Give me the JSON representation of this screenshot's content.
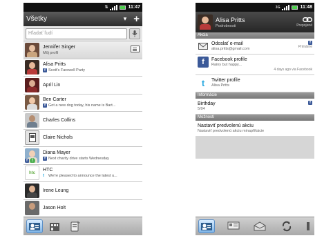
{
  "left": {
    "status": {
      "time": "11:47"
    },
    "header": {
      "title": "Všetky",
      "chevron": "▾",
      "add": "+"
    },
    "search": {
      "placeholder": "Hľadať ľudí"
    },
    "contacts": [
      {
        "name": "Jennifer Singer",
        "sub": "Môj profil",
        "icon": "none"
      },
      {
        "name": "Alisa Pritts",
        "sub": "Scott's Farewell Party",
        "icon": "facebook"
      },
      {
        "name": "April Lin",
        "sub": "",
        "icon": "none"
      },
      {
        "name": "Ben Carter",
        "sub": "Got a new dog today, his name is Bart...",
        "icon": "facebook"
      },
      {
        "name": "Charles Collins",
        "sub": "",
        "icon": "none"
      },
      {
        "name": "Claire Nichols",
        "sub": "",
        "icon": "none"
      },
      {
        "name": "Diana Mayer",
        "sub": "Next charity drive starts Wednesday",
        "icon": "facebook"
      },
      {
        "name": "HTC",
        "sub": "We're pleased to announce the latest u...",
        "icon": "twitter"
      },
      {
        "name": "Irene Leung",
        "sub": "",
        "icon": "none"
      },
      {
        "name": "Jason Holt",
        "sub": "",
        "icon": "none"
      }
    ],
    "htc_logo": "htc",
    "tabs": [
      "contacts-tab-icon",
      "groups-tab-icon",
      "call-history-tab-icon"
    ]
  },
  "right": {
    "status": {
      "time": "11:48",
      "network": "3G"
    },
    "header": {
      "name": "Alisa Pritts",
      "sub": "Podrobnosti",
      "link_label": "Prepojené"
    },
    "sections": {
      "akcia": "Akcia",
      "informacie": "Informácie",
      "moznosti": "Možnosti"
    },
    "actions": [
      {
        "main": "Odoslať e-mail",
        "sub": "alisa.pritts@gmail.com",
        "side": "Primárne"
      },
      {
        "main": "Facebook profile",
        "sub": "Rainy but happy...",
        "side": "4 days ago via Facebook"
      },
      {
        "main": "Twitter profile",
        "sub": "Alisa Pritts",
        "side": ""
      }
    ],
    "info": {
      "main": "Birthday",
      "sub": "5/04"
    },
    "option": {
      "main": "Nastaviť predvolenú akciu",
      "sub": "Nastaviť predvolenú akciu minapříkácie"
    },
    "tabs": [
      "details-tab-icon",
      "messages-tab-icon",
      "mail-tab-icon",
      "updates-tab-icon",
      "more-tab-icon"
    ]
  },
  "colors": {
    "facebook": "#3b5998",
    "twitter": "#2aa9e0",
    "active_tab": "#7fb4e6",
    "battery": "#4cd04c"
  }
}
